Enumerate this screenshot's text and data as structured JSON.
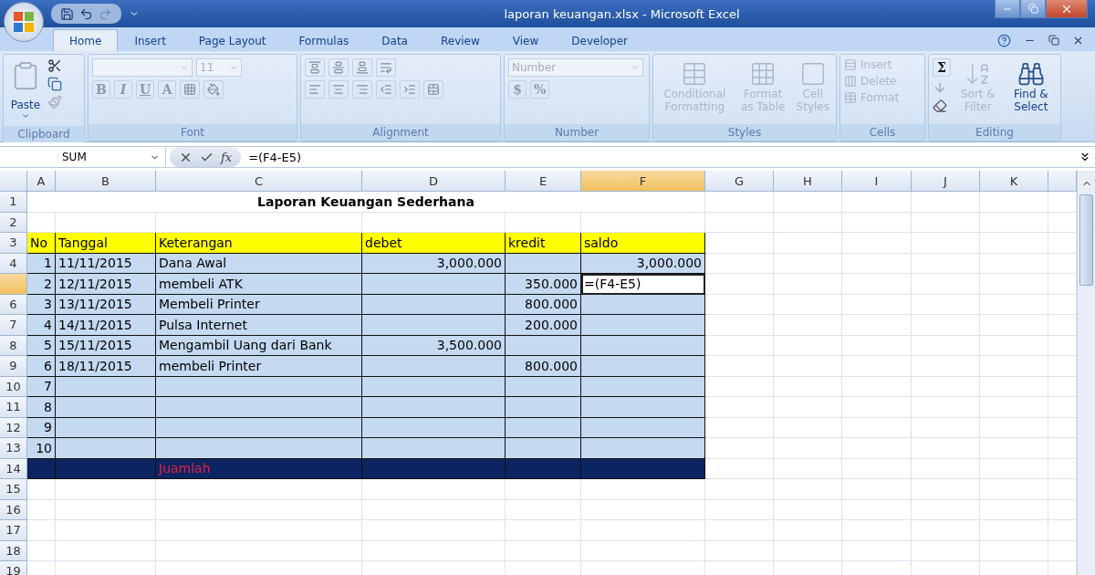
{
  "window": {
    "title": "laporan keuangan.xlsx - Microsoft Excel"
  },
  "ribbon_tabs": [
    {
      "label": "Home",
      "selected": true
    },
    {
      "label": "Insert",
      "selected": false
    },
    {
      "label": "Page Layout",
      "selected": false
    },
    {
      "label": "Formulas",
      "selected": false
    },
    {
      "label": "Data",
      "selected": false
    },
    {
      "label": "Review",
      "selected": false
    },
    {
      "label": "View",
      "selected": false
    },
    {
      "label": "Developer",
      "selected": false
    }
  ],
  "ribbon_groups": [
    {
      "label": "Clipboard",
      "kind": "clipboard",
      "large": [
        {
          "label": "Paste",
          "disabled": false
        }
      ]
    },
    {
      "label": "Font",
      "kind": "font",
      "size": "11",
      "glyphs": [
        {
          "text": "B",
          "disabled": true
        },
        {
          "text": "I",
          "disabled": true
        },
        {
          "text": "U",
          "disabled": true
        },
        {
          "text": "A",
          "disabled": true
        }
      ]
    },
    {
      "label": "Alignment",
      "kind": "alignment"
    },
    {
      "label": "Number",
      "kind": "number",
      "placeholder": "Number",
      "glyphs": [
        {
          "text": "$",
          "disabled": true
        },
        {
          "text": "%",
          "disabled": true
        }
      ]
    },
    {
      "label": "Styles",
      "kind": "styles",
      "large": [
        {
          "label": "Conditional Formatting",
          "disabled": true
        },
        {
          "label": "Format as Table",
          "disabled": true
        },
        {
          "label": "Cell Styles",
          "disabled": true
        }
      ]
    },
    {
      "label": "Cells",
      "kind": "cells",
      "large": [
        {
          "label": "Insert",
          "disabled": true
        },
        {
          "label": "Delete",
          "disabled": true
        },
        {
          "label": "Format",
          "disabled": true
        }
      ]
    },
    {
      "label": "Editing",
      "kind": "editing",
      "glyphs": [
        {
          "text": "Σ",
          "disabled": false
        }
      ],
      "large": [
        {
          "label": "Sort & Filter",
          "disabled": true
        },
        {
          "label": "Find & Select",
          "disabled": false
        }
      ]
    }
  ],
  "formula_bar": {
    "name_box": "SUM",
    "function_label": "fx",
    "formula": "=(F4-E5)"
  },
  "columns": [
    {
      "label": "A",
      "selected": false
    },
    {
      "label": "B",
      "selected": false
    },
    {
      "label": "C",
      "selected": false
    },
    {
      "label": "D",
      "selected": false
    },
    {
      "label": "E",
      "selected": false
    },
    {
      "label": "F",
      "selected": true
    },
    {
      "label": "G",
      "selected": false
    },
    {
      "label": "H",
      "selected": false
    },
    {
      "label": "I",
      "selected": false
    },
    {
      "label": "J",
      "selected": false
    },
    {
      "label": "K",
      "selected": false
    }
  ],
  "rows": [
    {
      "header": "1",
      "selected": false,
      "kind": "title",
      "cells": [
        {
          "text": "Laporan Keuangan Sederhana"
        }
      ]
    },
    {
      "header": "2",
      "selected": false,
      "kind": "plain",
      "cells": []
    },
    {
      "header": "3",
      "selected": false,
      "kind": "head",
      "cells": [
        {
          "text": "No"
        },
        {
          "text": "Tanggal"
        },
        {
          "text": "Keterangan"
        },
        {
          "text": "debet"
        },
        {
          "text": "kredit"
        },
        {
          "text": "saldo"
        }
      ]
    },
    {
      "header": "4",
      "selected": false,
      "kind": "data",
      "cells": [
        {
          "text": "1"
        },
        {
          "text": "11/11/2015"
        },
        {
          "text": "Dana Awal"
        },
        {
          "text": "3,000.000"
        },
        {},
        {
          "text": "3,000.000"
        }
      ]
    },
    {
      "selected": true,
      "kind": "data",
      "cells": [
        {
          "text": "2"
        },
        {
          "text": "12/11/2015"
        },
        {
          "text": "membeli ATK"
        },
        {},
        {
          "text": "350.000"
        },
        {
          "text": "=(F4-E5)"
        }
      ]
    },
    {
      "header": "6",
      "selected": false,
      "kind": "data",
      "cells": [
        {
          "text": "3"
        },
        {
          "text": "13/11/2015"
        },
        {
          "text": "Membeli Printer"
        },
        {},
        {
          "text": "800.000"
        },
        {}
      ]
    },
    {
      "header": "7",
      "selected": false,
      "kind": "data",
      "cells": [
        {
          "text": "4"
        },
        {
          "text": "14/11/2015"
        },
        {
          "text": "Pulsa Internet"
        },
        {},
        {
          "text": "200.000"
        },
        {}
      ]
    },
    {
      "header": "8",
      "selected": false,
      "kind": "data",
      "cells": [
        {
          "text": "5"
        },
        {
          "text": "15/11/2015"
        },
        {
          "text": "Mengambil Uang dari Bank"
        },
        {
          "text": "3,500.000"
        },
        {},
        {}
      ]
    },
    {
      "header": "9",
      "selected": false,
      "kind": "data",
      "cells": [
        {
          "text": "6"
        },
        {
          "text": "18/11/2015"
        },
        {
          "text": "membeli Printer"
        },
        {},
        {
          "text": "800.000"
        },
        {}
      ]
    },
    {
      "header": "10",
      "selected": false,
      "kind": "data",
      "cells": [
        {
          "text": "7"
        },
        {},
        {},
        {},
        {},
        {}
      ]
    },
    {
      "header": "11",
      "selected": false,
      "kind": "data",
      "cells": [
        {
          "text": "8"
        },
        {},
        {},
        {},
        {},
        {}
      ]
    },
    {
      "header": "12",
      "selected": false,
      "kind": "data",
      "cells": [
        {
          "text": "9"
        },
        {},
        {},
        {},
        {},
        {}
      ]
    },
    {
      "header": "13",
      "selected": false,
      "kind": "data",
      "cells": [
        {
          "text": "10"
        },
        {},
        {},
        {},
        {},
        {}
      ]
    },
    {
      "header": "14",
      "selected": false,
      "kind": "total",
      "cells": [
        {},
        {},
        {
          "text": "Juamlah"
        },
        {},
        {},
        {}
      ]
    },
    {
      "header": "15",
      "selected": false,
      "kind": "plain",
      "cells": []
    },
    {
      "header": "16",
      "selected": false,
      "kind": "plain",
      "cells": []
    },
    {
      "header": "17",
      "selected": false,
      "kind": "plain",
      "cells": []
    },
    {
      "header": "18",
      "selected": false,
      "kind": "plain",
      "cells": []
    },
    {
      "header": "19",
      "selected": false,
      "kind": "plain",
      "cells": []
    }
  ]
}
